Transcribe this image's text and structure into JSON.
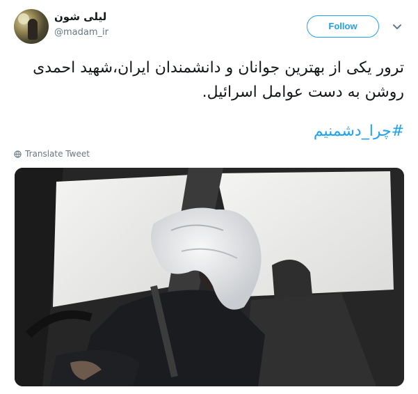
{
  "user": {
    "display_name": "لیلی شون",
    "handle": "@madam_ir"
  },
  "actions": {
    "follow_label": "Follow"
  },
  "tweet": {
    "text": "ترور یکی از بهترین جوانان و دانشمندان ایران،شهید احمدی روشن به دست عوامل اسرائیل.",
    "hashtag": "#چرا_دشمنیم",
    "translate_label": "Translate Tweet"
  },
  "colors": {
    "accent": "#1da1f2",
    "muted": "#657786",
    "text": "#14171a"
  },
  "icons": {
    "menu": "chevron-down-icon",
    "translate": "globe-icon"
  }
}
